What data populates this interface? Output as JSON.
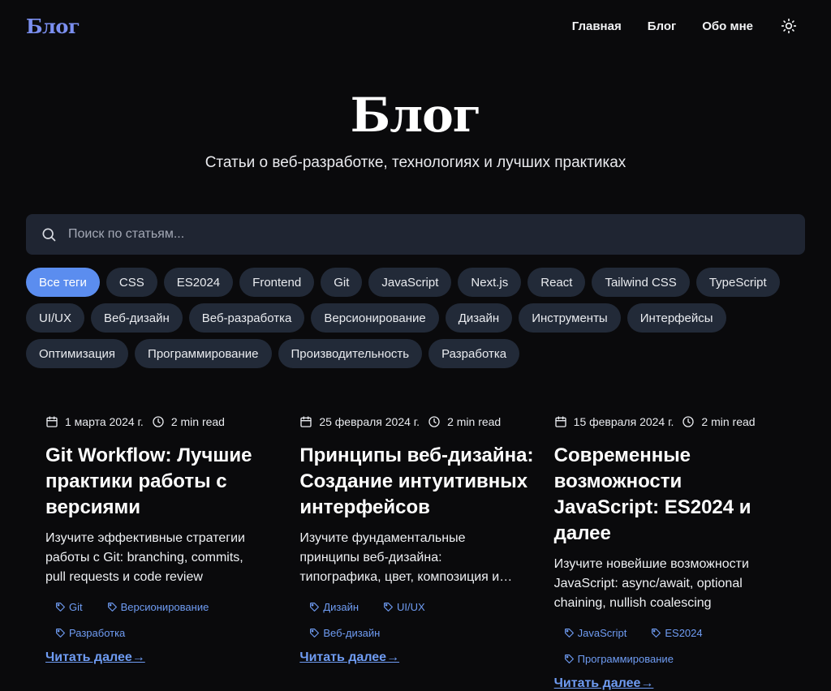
{
  "header": {
    "logo": "Блог",
    "nav": [
      "Главная",
      "Блог",
      "Обо мне"
    ],
    "theme_icon": "sun-icon"
  },
  "hero": {
    "title": "Блог",
    "subtitle": "Статьи о веб-разработке, технологиях и лучших практиках"
  },
  "search": {
    "placeholder": "Поиск по статьям...",
    "value": ""
  },
  "tags": [
    "Все теги",
    "CSS",
    "ES2024",
    "Frontend",
    "Git",
    "JavaScript",
    "Next.js",
    "React",
    "Tailwind CSS",
    "TypeScript",
    "UI/UX",
    "Веб-дизайн",
    "Веб-разработка",
    "Версионирование",
    "Дизайн",
    "Инструменты",
    "Интерфейсы",
    "Оптимизация",
    "Программирование",
    "Производительность",
    "Разработка"
  ],
  "active_tag": "Все теги",
  "posts": [
    {
      "date": "1 марта 2024 г.",
      "read_time": "2 min read",
      "title": "Git Workflow: Лучшие практики работы с версиями",
      "excerpt": "Изучите эффективные стратегии работы с Git: branching, commits, pull requests и code review",
      "tags": [
        "Git",
        "Версионирование",
        "Разработка"
      ],
      "read_more": "Читать далее→"
    },
    {
      "date": "25 февраля 2024 г.",
      "read_time": "2 min read",
      "title": "Принципы веб-дизайна: Создание интуитивных интерфейсов",
      "excerpt": "Изучите фундаментальные принципы веб-дизайна: типографика, цвет, композиция и юзабилити",
      "tags": [
        "Дизайн",
        "UI/UX",
        "Веб-дизайн"
      ],
      "read_more": "Читать далее→"
    },
    {
      "date": "15 февраля 2024 г.",
      "read_time": "2 min read",
      "title": "Современные возможности JavaScript: ES2024 и далее",
      "excerpt": "Изучите новейшие возможности JavaScript: async/await, optional chaining, nullish coalescing",
      "tags": [
        "JavaScript",
        "ES2024",
        "Программирование"
      ],
      "read_more": "Читать далее→"
    }
  ],
  "colors": {
    "accent": "#5b8def",
    "logo": "#7b8ff0",
    "link": "#6f9cf3",
    "background": "#0a0a0c",
    "surface": "#1f2532",
    "pill": "#222a38"
  }
}
